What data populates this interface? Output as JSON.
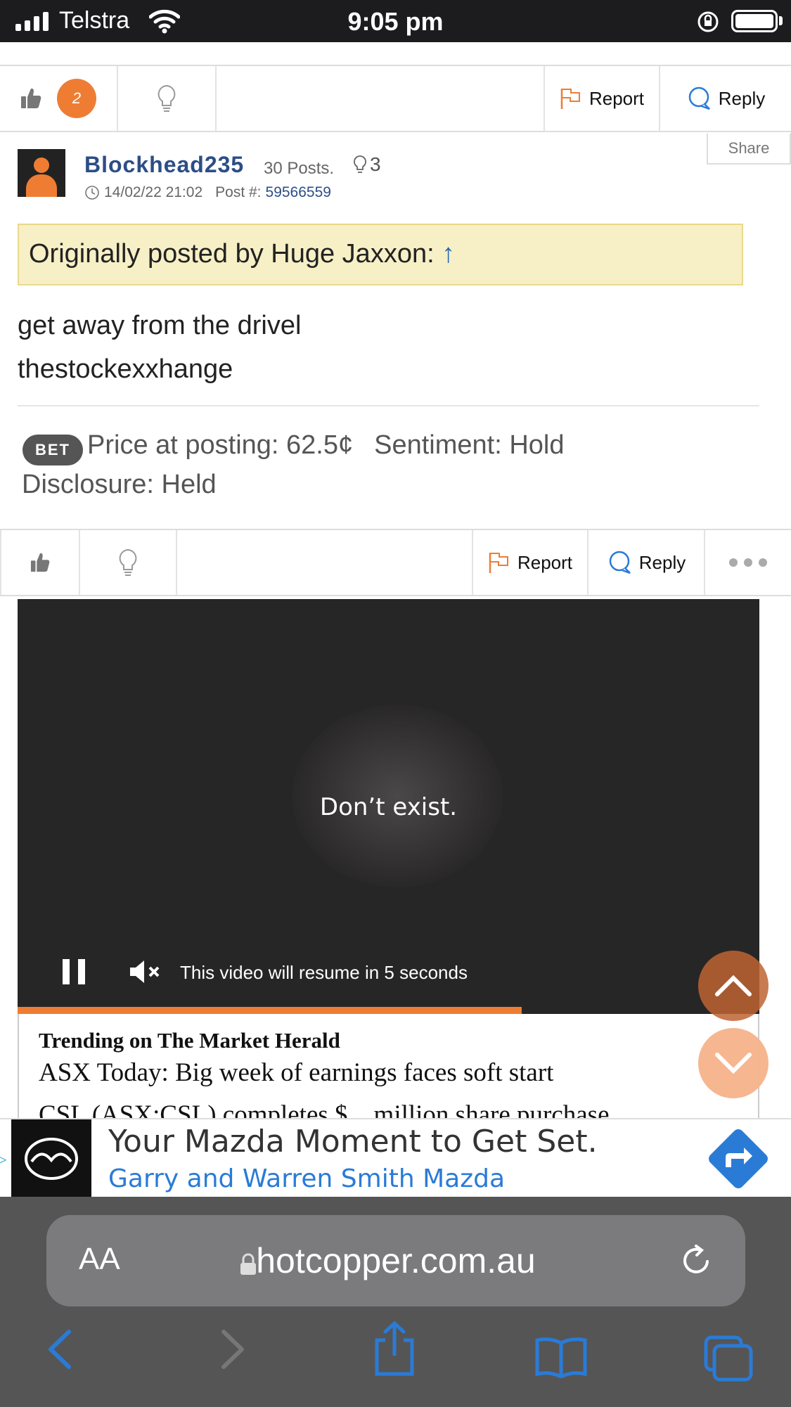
{
  "status_bar": {
    "carrier": "Telstra",
    "time": "9:05 pm"
  },
  "top_actions": {
    "like_count": "2",
    "report_label": "Report",
    "reply_label": "Reply"
  },
  "post": {
    "share_label": "Share",
    "username": "Blockhead235",
    "posts": "30 Posts.",
    "lightbulbs": "3",
    "timestamp": "14/02/22 21:02",
    "post_number_label": "Post #:",
    "post_number": "59566559",
    "quote_text": "Originally posted by Huge Jaxxon:",
    "quote_arrow": "↑",
    "body_line1": "get away from the drivel",
    "body_line2": "thestockexxhange",
    "ticker": "BET",
    "price": "Price at posting: 62.5¢",
    "sentiment": "Sentiment: Hold",
    "disclosure": "Disclosure: Held"
  },
  "post_actions": {
    "report_label": "Report",
    "reply_label": "Reply"
  },
  "video_ad": {
    "caption": "Don’t exist.",
    "resume_text": "This video will resume in 5 seconds",
    "progress": 0.68
  },
  "trending": {
    "heading": "Trending on The Market Herald",
    "item1": "ASX Today: Big week of earnings faces soft start",
    "item2": "CSL (ASX:CSL) completes $... million share purchase"
  },
  "banner_ad": {
    "title": "Your Mazda Moment to Get Set.",
    "subtitle": "Garry and Warren Smith Mazda"
  },
  "safari": {
    "text_size_label": "AA",
    "url": "hotcopper.com.au"
  },
  "colors": {
    "accent_orange": "#ee7d33",
    "link_blue": "#2c4e86",
    "ios_blue": "#2a7bd6"
  }
}
